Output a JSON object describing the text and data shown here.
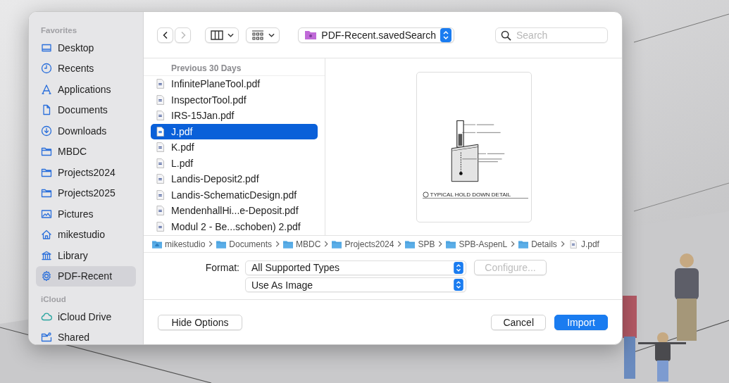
{
  "sidebar": {
    "sections": [
      {
        "heading": "Favorites",
        "items": [
          {
            "label": "Desktop",
            "kind": "desktop",
            "selected": false
          },
          {
            "label": "Recents",
            "kind": "clock",
            "selected": false
          },
          {
            "label": "Applications",
            "kind": "apps",
            "selected": false
          },
          {
            "label": "Documents",
            "kind": "doc",
            "selected": false
          },
          {
            "label": "Downloads",
            "kind": "download",
            "selected": false
          },
          {
            "label": "MBDC",
            "kind": "folder",
            "selected": false
          },
          {
            "label": "Projects2024",
            "kind": "folder",
            "selected": false
          },
          {
            "label": "Projects2025",
            "kind": "folder",
            "selected": false
          },
          {
            "label": "Pictures",
            "kind": "picture",
            "selected": false
          },
          {
            "label": "mikestudio",
            "kind": "home",
            "selected": false
          },
          {
            "label": "Library",
            "kind": "library",
            "selected": false
          },
          {
            "label": "PDF-Recent",
            "kind": "gear",
            "selected": true
          }
        ]
      },
      {
        "heading": "iCloud",
        "items": [
          {
            "label": "iCloud Drive",
            "kind": "cloud",
            "selected": false
          },
          {
            "label": "Shared",
            "kind": "shared",
            "selected": false
          }
        ]
      }
    ]
  },
  "toolbar": {
    "back": {
      "disabled": false
    },
    "forward": {
      "disabled": true
    },
    "location": "PDF-Recent.savedSearch",
    "search": {
      "placeholder": "Search"
    }
  },
  "files": {
    "heading": "Previous 30 Days",
    "items": [
      {
        "name": "InfinitePlaneTool.pdf",
        "selected": false
      },
      {
        "name": "InspectorTool.pdf",
        "selected": false
      },
      {
        "name": "IRS-15Jan.pdf",
        "selected": false
      },
      {
        "name": "J.pdf",
        "selected": true
      },
      {
        "name": "K.pdf",
        "selected": false
      },
      {
        "name": "L.pdf",
        "selected": false
      },
      {
        "name": "Landis-Deposit2.pdf",
        "selected": false
      },
      {
        "name": "Landis-SchematicDesign.pdf",
        "selected": false
      },
      {
        "name": "MendenhallHi...e-Deposit.pdf",
        "selected": false
      },
      {
        "name": "Modul 2 - Be...schoben) 2.pdf",
        "selected": false
      }
    ]
  },
  "preview": {
    "caption": "TYPICAL HOLD DOWN DETAIL"
  },
  "path": [
    {
      "name": "mikestudio",
      "kind": "home"
    },
    {
      "name": "Documents",
      "kind": "folder"
    },
    {
      "name": "MBDC",
      "kind": "folder"
    },
    {
      "name": "Projects2024",
      "kind": "folder"
    },
    {
      "name": "SPB",
      "kind": "folder"
    },
    {
      "name": "SPB-AspenL",
      "kind": "folder"
    },
    {
      "name": "Details",
      "kind": "folder"
    },
    {
      "name": "J.pdf",
      "kind": "file"
    }
  ],
  "options": {
    "format_label": "Format:",
    "format": "All Supported Types",
    "configure": {
      "label": "Configure...",
      "disabled": true
    },
    "use_as": "Use As Image"
  },
  "bottom": {
    "left": [
      {
        "label": "Hide Options",
        "default": false
      }
    ],
    "right": [
      {
        "label": "Cancel",
        "default": false
      },
      {
        "label": "Import",
        "default": true
      }
    ]
  }
}
